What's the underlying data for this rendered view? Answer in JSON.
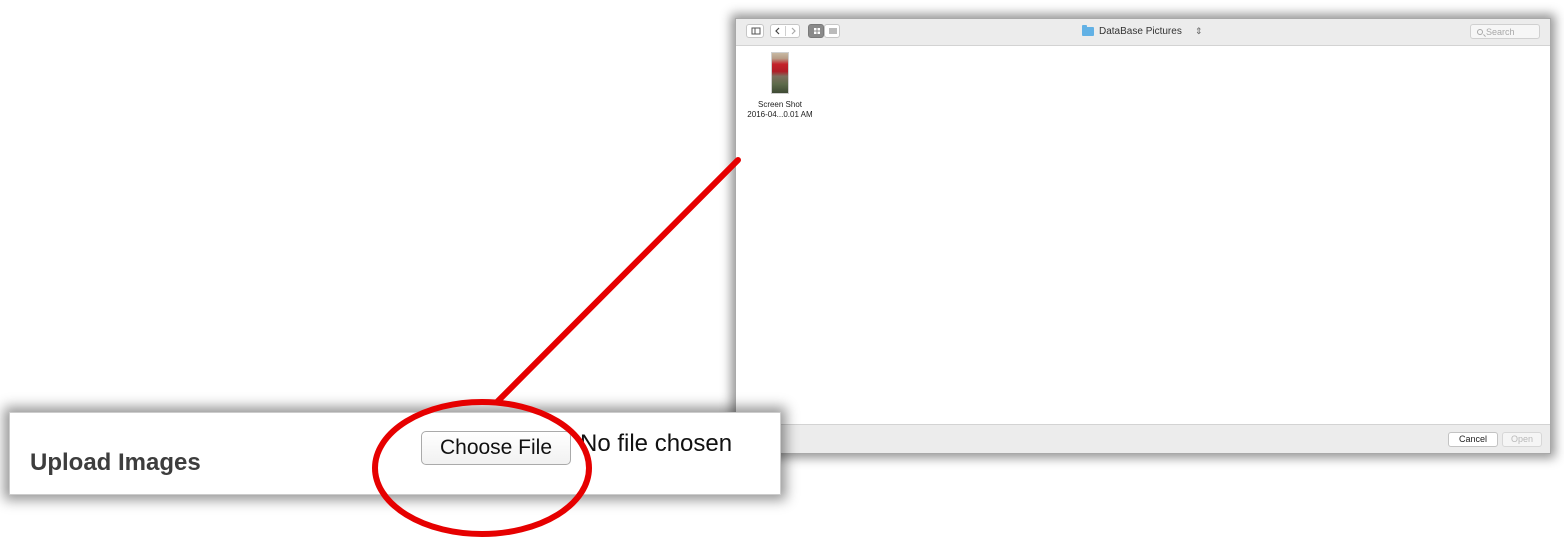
{
  "dialog": {
    "location": "DataBase Pictures",
    "search_placeholder": "Search",
    "files": [
      {
        "name_line1": "Screen Shot",
        "name_line2": "2016-04...0.01 AM"
      }
    ],
    "cancel_label": "Cancel",
    "open_label": "Open"
  },
  "upload": {
    "title": "Upload Images",
    "choose_label": "Choose File",
    "status": "No file chosen"
  },
  "colors": {
    "annotation": "#e60000",
    "folder": "#62b1e5"
  },
  "icons": {
    "sidebar_toggle": "sidebar-toggle-icon",
    "back": "chevron-left-icon",
    "forward": "chevron-right-icon",
    "grid_view": "grid-view-icon",
    "list_view": "list-view-icon",
    "folder": "folder-icon",
    "search": "search-icon"
  }
}
